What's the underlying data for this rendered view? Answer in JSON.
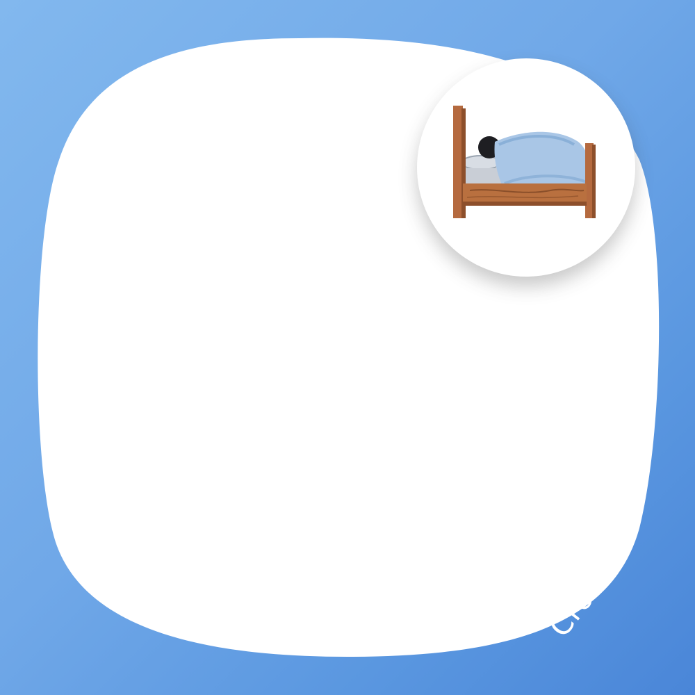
{
  "colors": {
    "background_start": "#82b8ee",
    "background_end": "#4a86d8",
    "card": "#ffffff"
  },
  "badge": {
    "icon": "sleeping-in-bed-icon"
  },
  "watermark": {
    "text": "Crofile"
  }
}
